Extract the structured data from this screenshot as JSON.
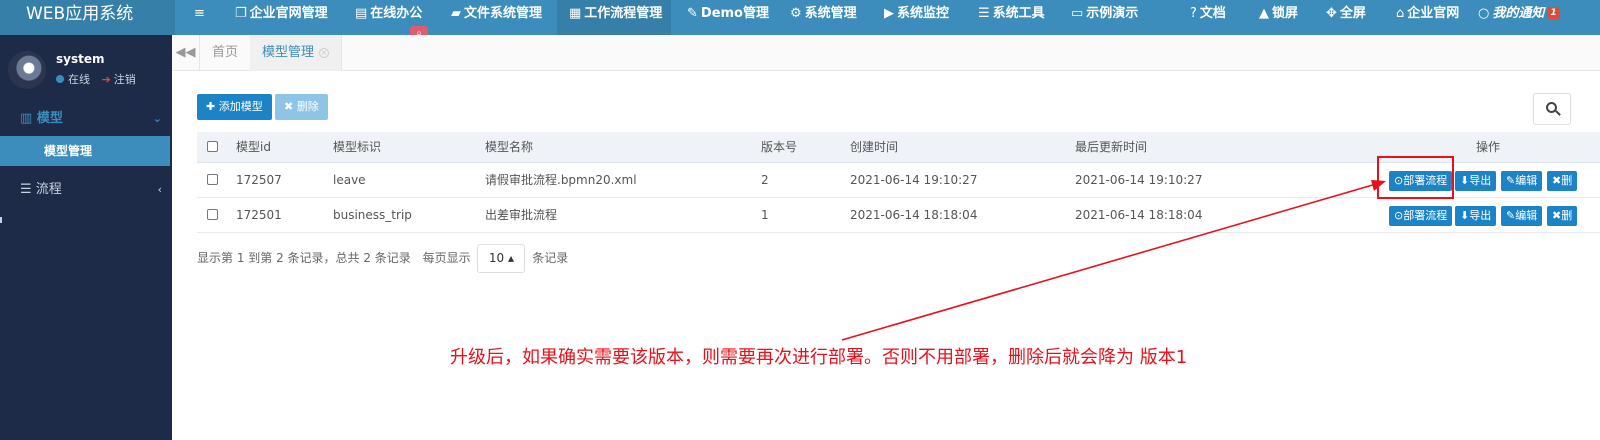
{
  "app": {
    "brand": "WEB应用系统"
  },
  "topnav": {
    "items": [
      {
        "icon": "≡",
        "label": ""
      },
      {
        "icon": "❐",
        "label": "企业官网管理"
      },
      {
        "icon": "▤",
        "label": "在线办公"
      },
      {
        "icon": "▰",
        "label": "文件系统管理"
      },
      {
        "icon": "▦",
        "label": "工作流程管理"
      },
      {
        "icon": "✎",
        "label": "Demo管理"
      },
      {
        "icon": "⚙",
        "label": "系统管理"
      },
      {
        "icon": "▶",
        "label": "系统监控"
      },
      {
        "icon": "☰",
        "label": "系统工具"
      },
      {
        "icon": "▭",
        "label": "示例演示"
      }
    ],
    "right": [
      {
        "icon": "?",
        "label": "文档"
      },
      {
        "icon": "▲",
        "label": "锁屏"
      },
      {
        "icon": "✥",
        "label": "全屏"
      },
      {
        "icon": "⌂",
        "label": "企业官网"
      },
      {
        "icon": "○",
        "label": "我的通知",
        "badge": "1"
      }
    ],
    "search_icon": "⌕"
  },
  "user": {
    "name": "system",
    "status": "在线",
    "logout": "注销"
  },
  "sidebar": {
    "groups": [
      {
        "icon": "▥",
        "label": "模型",
        "caret": "⌄"
      },
      {
        "icon": "☰",
        "label": "流程",
        "caret": "‹"
      }
    ],
    "active_item": "模型管理"
  },
  "tabs": {
    "back_icon": "◀◀",
    "items": [
      "首页",
      "模型管理"
    ],
    "close_icon": "✕"
  },
  "toolbar": {
    "add_label": "✚ 添加模型",
    "delete_label": "✖ 删除"
  },
  "table": {
    "headers": [
      "模型id",
      "模型标识",
      "模型名称",
      "版本号",
      "创建时间",
      "最后更新时间",
      "操作"
    ],
    "rows": [
      [
        "172507",
        "leave",
        "请假审批流程.bpmn20.xml",
        "2",
        "2021-06-14 19:10:27",
        "2021-06-14 19:10:27"
      ],
      [
        "172501",
        "business_trip",
        "出差审批流程",
        "1",
        "2021-06-14 18:18:04",
        "2021-06-14 18:18:04"
      ]
    ],
    "actions": [
      "⊙部署流程",
      "⬇导出",
      "✎编辑",
      "✖删"
    ]
  },
  "pager": {
    "summary": "显示第 1 到第 2 条记录，总共 2 条记录",
    "per_page_label": "每页显示",
    "page_size": "10 ▴",
    "suffix": "条记录"
  },
  "annotation": {
    "text": "升级后，如果确实需要该版本，则需要再次进行部署。否则不用部署，删除后就会降为 版本1",
    "color": "#e8101a"
  },
  "colors": {
    "topbar": "#3c8dbc",
    "sidebar": "#1d2b49",
    "primary_button": "#1c84c6",
    "annotation": "#e8101a"
  }
}
